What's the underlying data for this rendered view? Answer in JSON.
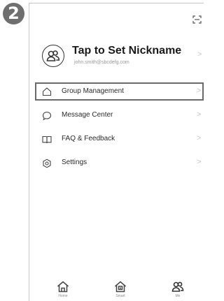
{
  "step_number": "2",
  "profile": {
    "nickname": "Tap to Set Nickname",
    "email": "john.smith@sbcdefg.com",
    "chevron": ">"
  },
  "menu": [
    {
      "label": "Group Management",
      "icon": "home-outline-icon",
      "chevron": ">",
      "highlighted": true
    },
    {
      "label": "Message Center",
      "icon": "chat-bubble-icon",
      "chevron": ">"
    },
    {
      "label": "FAQ & Feedback",
      "icon": "book-icon",
      "chevron": ">"
    },
    {
      "label": "Settings",
      "icon": "gear-icon",
      "chevron": ">"
    }
  ],
  "tabs": [
    {
      "label": "Home",
      "icon": "home-icon"
    },
    {
      "label": "Smart",
      "icon": "smart-home-icon"
    },
    {
      "label": "Me",
      "icon": "user-group-icon"
    }
  ],
  "colors": {
    "highlight_border": "#6a6a6a",
    "badge": "#6f6f6f",
    "chevron": "#c9c9c9"
  }
}
